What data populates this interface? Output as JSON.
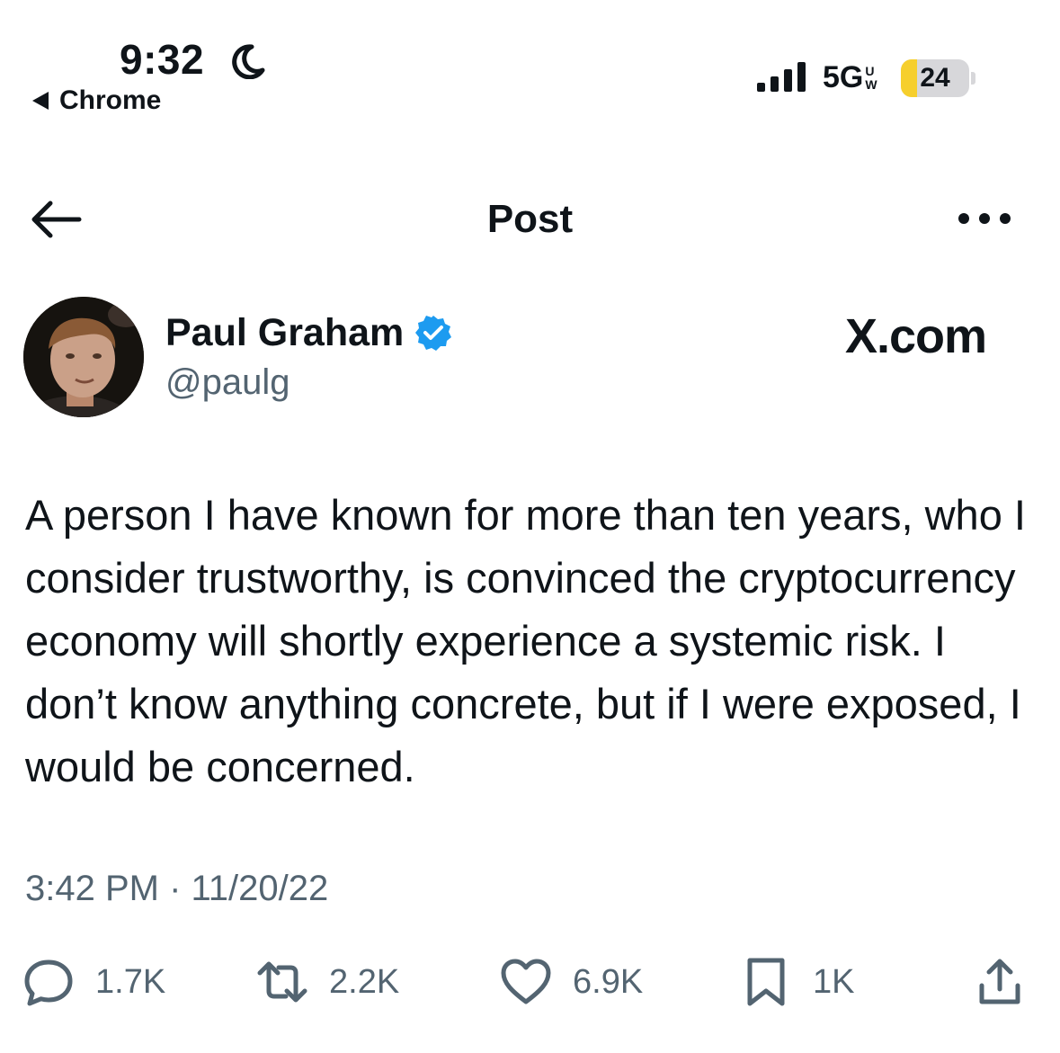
{
  "status_bar": {
    "time": "9:32",
    "back_app": "Chrome",
    "network": "5G",
    "network_sup": "U",
    "network_sub": "W",
    "battery_level": "24",
    "battery_fraction": 0.24
  },
  "nav": {
    "title": "Post"
  },
  "author": {
    "name": "Paul Graham",
    "handle": "@paulg",
    "verified": true
  },
  "brand": "X.com",
  "tweet": {
    "text": "A person I have known for more than ten years, who I consider trustworthy, is convinced the cryptocurrency economy will shortly experience a systemic risk. I don’t know anything concrete, but if I were exposed, I would be concerned.",
    "timestamp": "3:42 PM · 11/20/22"
  },
  "actions": {
    "replies": "1.7K",
    "reposts": "2.2K",
    "likes": "6.9K",
    "bookmarks": "1K"
  },
  "icons": [
    "moon-icon",
    "signal-icon",
    "back-arrow-icon",
    "more-icon",
    "verified-icon",
    "reply-icon",
    "repost-icon",
    "like-icon",
    "bookmark-icon",
    "share-icon"
  ],
  "colors": {
    "verified": "#1d9bf0",
    "muted_text": "#536471",
    "battery_fill": "#f6cf2d"
  }
}
